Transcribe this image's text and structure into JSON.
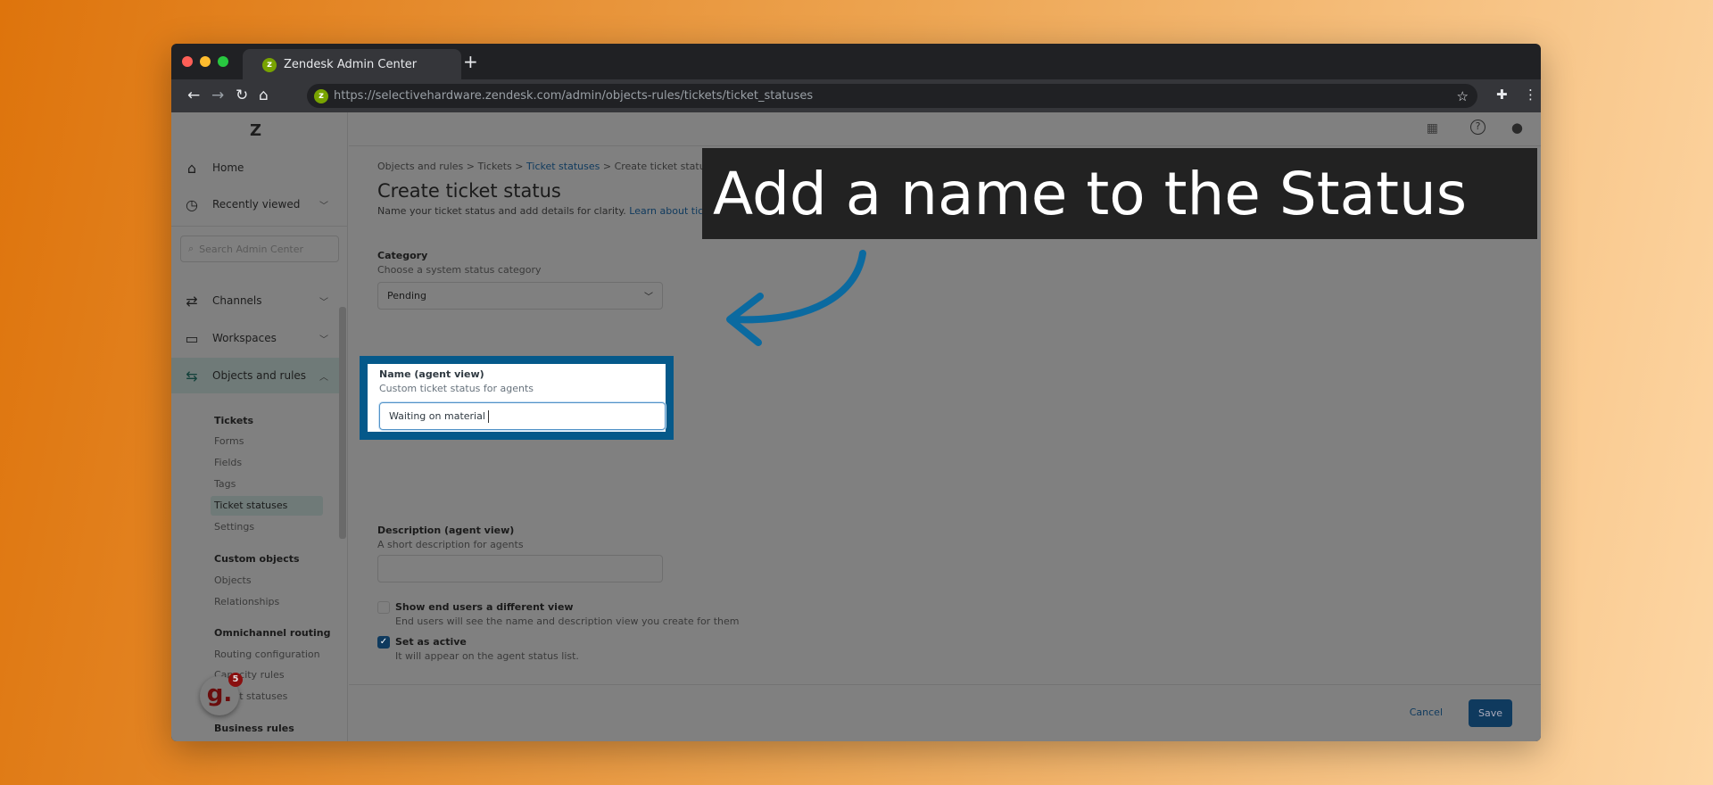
{
  "browser": {
    "tab_title": "Zendesk Admin Center",
    "url": "https://selectivehardware.zendesk.com/admin/objects-rules/tickets/ticket_statuses"
  },
  "sidebar": {
    "home": "Home",
    "recently_viewed": "Recently viewed",
    "search_placeholder": "Search Admin Center",
    "channels": "Channels",
    "workspaces": "Workspaces",
    "objects_rules": "Objects and rules",
    "groups": [
      {
        "title": "Tickets",
        "items": [
          "Forms",
          "Fields",
          "Tags",
          "Ticket statuses",
          "Settings"
        ]
      },
      {
        "title": "Custom objects",
        "items": [
          "Objects",
          "Relationships"
        ]
      },
      {
        "title": "Omnichannel routing",
        "items": [
          "Routing configuration",
          "Capacity rules",
          "Agent statuses"
        ]
      },
      {
        "title": "Business rules",
        "items": []
      }
    ],
    "active_item": "Ticket statuses",
    "badge_count": "5"
  },
  "breadcrumb": [
    "Objects and rules",
    "Tickets",
    "Ticket statuses",
    "Create ticket status"
  ],
  "main": {
    "title": "Create ticket status",
    "subtitle": "Name your ticket status and add details for clarity.",
    "learn_link": "Learn about ticket statuses",
    "category_label": "Category",
    "category_sub": "Choose a system status category",
    "category_value": "Pending",
    "name_label": "Name (agent view)",
    "name_sub": "Custom ticket status for agents",
    "name_value": "Waiting on material",
    "desc_label": "Description (agent view)",
    "desc_sub": "A short description for agents",
    "desc_value": "",
    "enduser_label": "Show end users a different view",
    "enduser_sub": "End users will see the name and description view you create for them",
    "enduser_checked": false,
    "active_label": "Set as active",
    "active_sub": "It will appear on the agent status list.",
    "active_checked": true
  },
  "footer": {
    "cancel": "Cancel",
    "save": "Save"
  },
  "callout": {
    "text": "Add a name to the Status"
  },
  "colors": {
    "highlight": "#05598a",
    "save": "#0f3a5e",
    "callout_bg": "#222222"
  }
}
